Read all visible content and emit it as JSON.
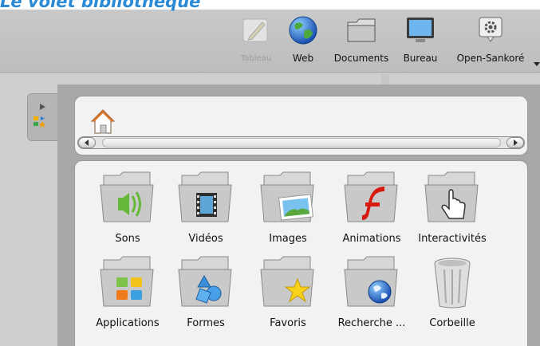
{
  "heading": "Le volet bibliothèque",
  "toolbar": {
    "buttons": [
      {
        "label": "Tableau",
        "icon": "board-icon",
        "enabled": false
      },
      {
        "label": "Web",
        "icon": "globe-icon",
        "enabled": true
      },
      {
        "label": "Documents",
        "icon": "documents-folder-icon",
        "enabled": true
      },
      {
        "label": "Bureau",
        "icon": "desktop-monitor-icon",
        "enabled": true
      },
      {
        "label": "Open-Sankoré",
        "icon": "gear-icon",
        "enabled": true
      }
    ]
  },
  "library": {
    "items": [
      {
        "label": "Sons",
        "icon": "sounds-folder-icon"
      },
      {
        "label": "Vidéos",
        "icon": "videos-folder-icon"
      },
      {
        "label": "Images",
        "icon": "images-folder-icon"
      },
      {
        "label": "Animations",
        "icon": "animations-folder-icon"
      },
      {
        "label": "Interactivités",
        "icon": "interactivities-folder-icon"
      },
      {
        "label": "Applications",
        "icon": "applications-folder-icon"
      },
      {
        "label": "Formes",
        "icon": "shapes-folder-icon"
      },
      {
        "label": "Favoris",
        "icon": "favorites-folder-icon"
      },
      {
        "label": "Recherche ...",
        "icon": "search-folder-icon"
      },
      {
        "label": "Corbeille",
        "icon": "trash-icon"
      }
    ]
  },
  "colors": {
    "heading": "#2a8ad6",
    "panel": "#f2f2f2",
    "toolbar": "#c4c4c4"
  }
}
